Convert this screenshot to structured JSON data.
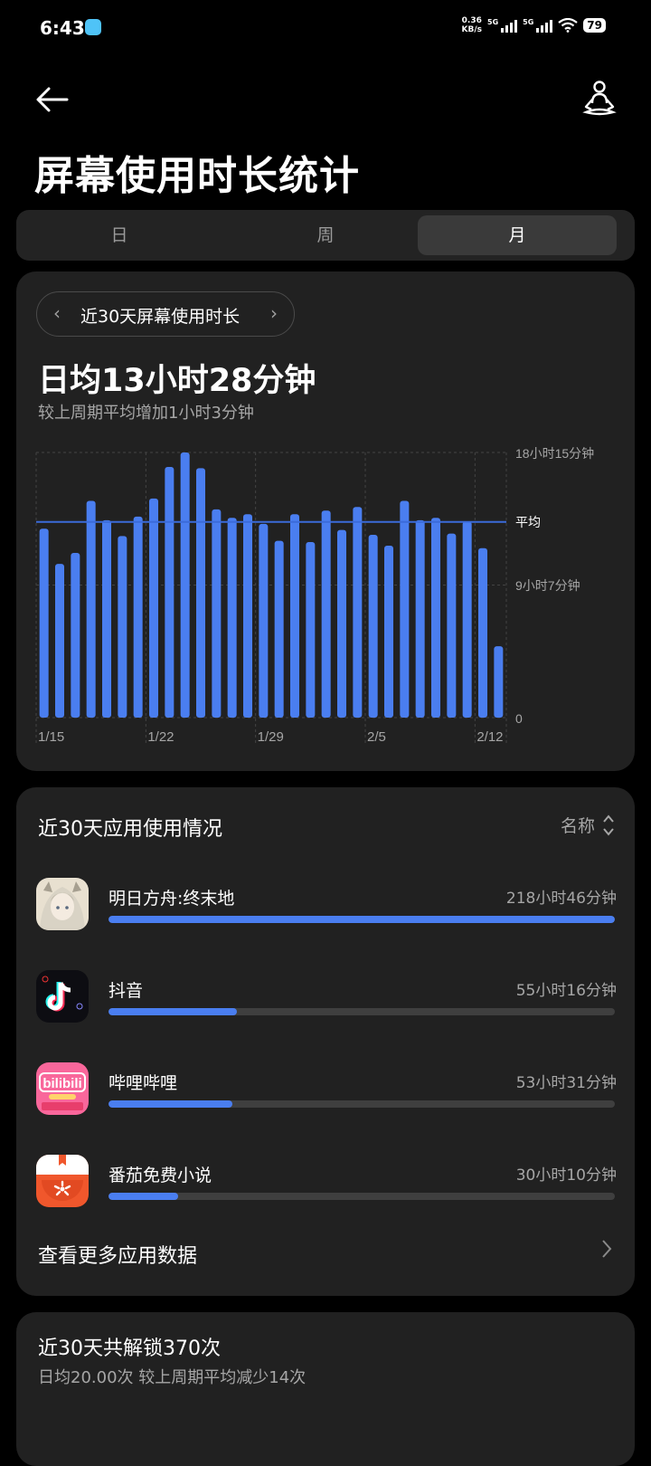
{
  "status": {
    "time": "6:43",
    "net_speed": "0.36",
    "net_unit": "KB/s",
    "sim1": "5G",
    "sim2": "5G",
    "battery": "79"
  },
  "header": {
    "title": "屏幕使用时长统计"
  },
  "tabs": [
    {
      "label": "日",
      "active": false
    },
    {
      "label": "周",
      "active": false
    },
    {
      "label": "月",
      "active": true
    }
  ],
  "summary": {
    "range_label": "近30天屏幕使用时长",
    "daily_avg": "日均13小时28分钟",
    "compare": "较上周期平均增加1小时3分钟"
  },
  "chart_data": {
    "type": "bar",
    "bar_color": "#4a7ef0",
    "average_line_color": "#3b6bd9",
    "x_tick_labels": [
      "1/15",
      "1/22",
      "1/29",
      "2/5",
      "2/12"
    ],
    "y_tick_labels": [
      "18小时15分钟",
      "9小时7分钟",
      "0"
    ],
    "average_label": "平均",
    "ylim_minutes": [
      0,
      1095
    ],
    "average_minutes": 808,
    "unit": "minutes",
    "values": [
      780,
      635,
      680,
      895,
      815,
      750,
      830,
      905,
      1035,
      1095,
      1030,
      860,
      825,
      840,
      800,
      730,
      840,
      725,
      855,
      775,
      870,
      755,
      710,
      895,
      815,
      825,
      760,
      810,
      700,
      295
    ]
  },
  "apps": {
    "title": "近30天应用使用情况",
    "sort_label": "名称",
    "items": [
      {
        "name": "明日方舟:终末地",
        "time": "218小时46分钟",
        "fraction": 1.0
      },
      {
        "name": "抖音",
        "time": "55小时16分钟",
        "fraction": 0.253
      },
      {
        "name": "哔哩哔哩",
        "time": "53小时31分钟",
        "fraction": 0.245
      },
      {
        "name": "番茄免费小说",
        "time": "30小时10分钟",
        "fraction": 0.138
      }
    ],
    "more_label": "查看更多应用数据"
  },
  "unlock": {
    "title": "近30天共解锁370次",
    "subtitle": "日均20.00次 较上周期平均减少14次"
  },
  "icons": [
    "back-arrow-icon",
    "meditation-icon",
    "chevron-left-icon",
    "chevron-right-icon",
    "sort-icon"
  ]
}
